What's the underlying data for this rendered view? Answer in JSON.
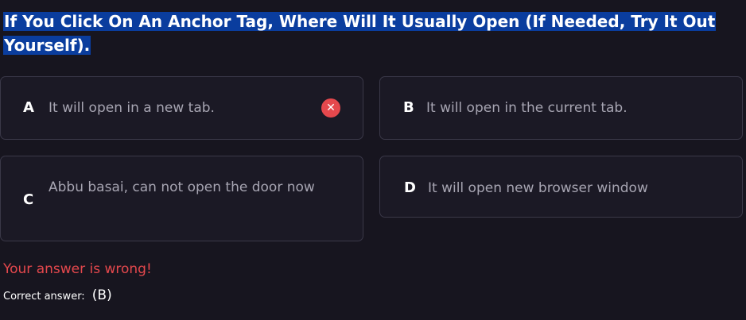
{
  "question": {
    "text": "If You Click On An Anchor Tag, Where Will It Usually Open (If Needed, Try It Out Yourself)."
  },
  "options": [
    {
      "letter": "A",
      "text": "It will open in a new tab.",
      "status": "selected-wrong"
    },
    {
      "letter": "B",
      "text": "It will open in the current tab.",
      "status": ""
    },
    {
      "letter": "C",
      "text": "Abbu basai, can not open the door now",
      "status": ""
    },
    {
      "letter": "D",
      "text": "It will open new browser window",
      "status": ""
    }
  ],
  "wrong_icon": {
    "icon": "close-icon",
    "glyph": "✕",
    "color": "#e5484d"
  },
  "feedback": {
    "message": "Your answer is wrong!",
    "correct_label": "Correct answer:",
    "correct_value": "(B)"
  },
  "colors": {
    "background": "#17151f",
    "highlight": "#0a3d9e",
    "error": "#e5484d",
    "option_border": "#3a3848"
  }
}
